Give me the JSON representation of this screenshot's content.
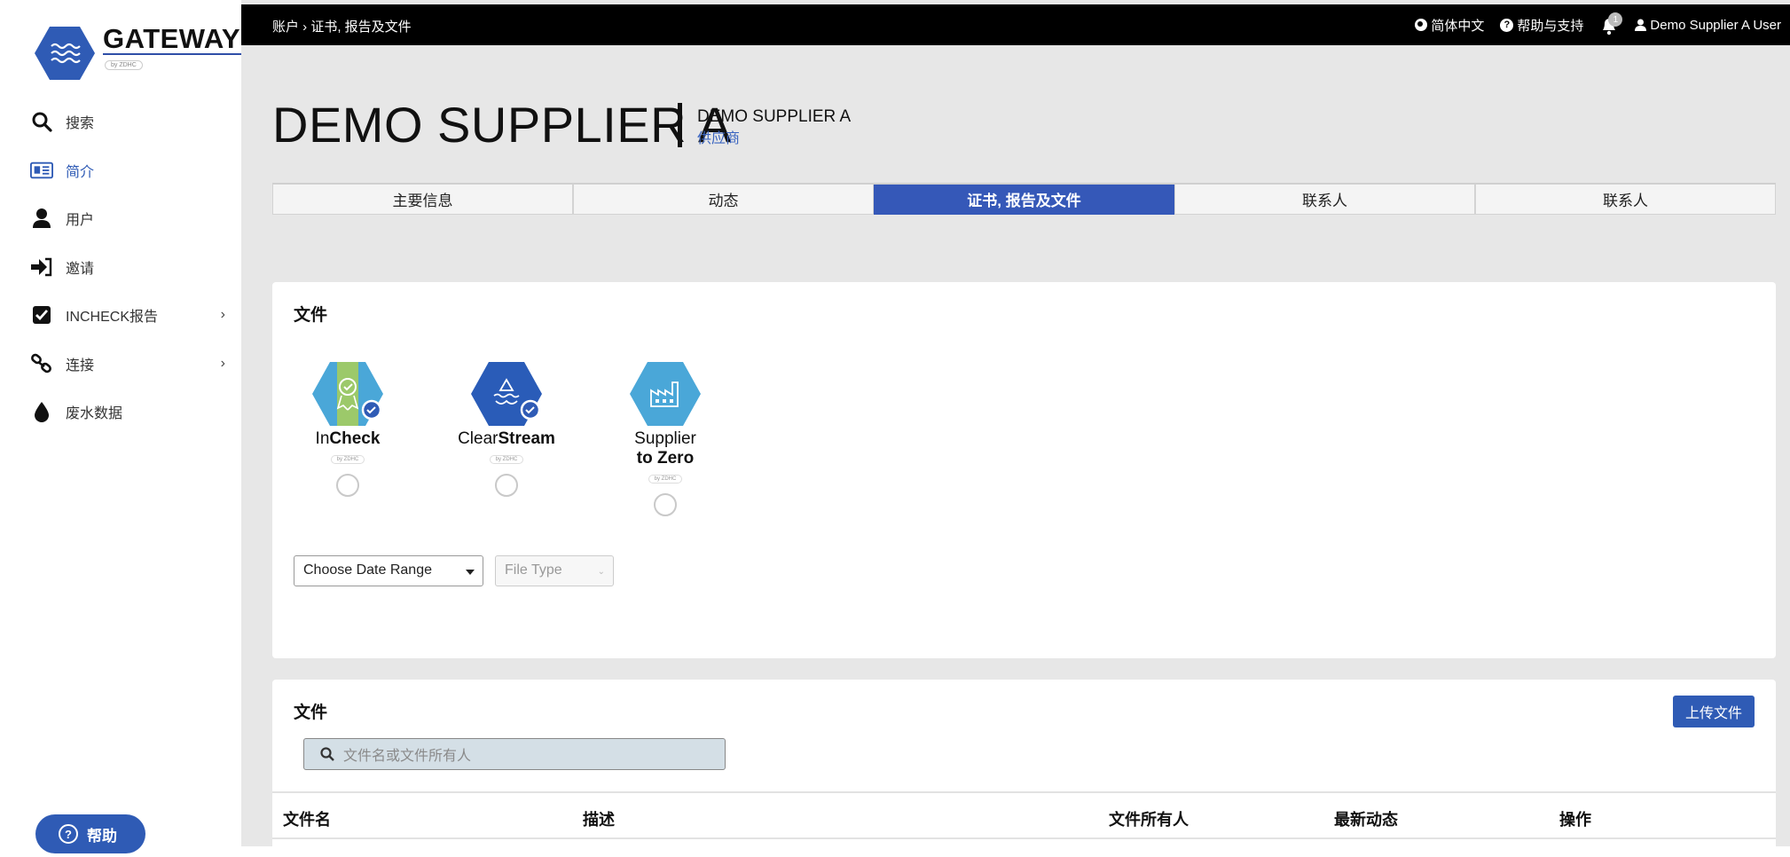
{
  "brand": {
    "name": "GATEWAY",
    "byline": "by ZDHC"
  },
  "sidebar": {
    "items": [
      {
        "label": "搜索",
        "icon": "search-icon",
        "active": false,
        "has_submenu": false
      },
      {
        "label": "简介",
        "icon": "profile-card-icon",
        "active": true,
        "has_submenu": false
      },
      {
        "label": "用户",
        "icon": "user-icon",
        "active": false,
        "has_submenu": false
      },
      {
        "label": "邀请",
        "icon": "invite-icon",
        "active": false,
        "has_submenu": false
      },
      {
        "label": "INCHECK报告",
        "icon": "checkbox-icon",
        "active": false,
        "has_submenu": true
      },
      {
        "label": "连接",
        "icon": "link-icon",
        "active": false,
        "has_submenu": true
      },
      {
        "label": "废水数据",
        "icon": "water-drop-icon",
        "active": false,
        "has_submenu": false
      }
    ],
    "help_label": "帮助"
  },
  "topbar": {
    "breadcrumb": "账户 › 证书, 报告及文件",
    "language": "简体中文",
    "help": "帮助与支持",
    "notification_count": "1",
    "user": "Demo Supplier A User"
  },
  "header": {
    "title": "DEMO SUPPLIER A",
    "subtitle": "DEMO SUPPLIER A",
    "role": "供应商"
  },
  "tabs": [
    {
      "label": "主要信息",
      "active": false
    },
    {
      "label": "动态",
      "active": false
    },
    {
      "label": "证书, 报告及文件",
      "active": true
    },
    {
      "label": "联系人",
      "active": false
    },
    {
      "label": "联系人",
      "active": false
    }
  ],
  "documents_card": {
    "title": "文件",
    "programs": [
      {
        "name_light": "In",
        "name_bold": "Check",
        "byline": "by ZDHC",
        "selected": false,
        "color": "#4aa7d8"
      },
      {
        "name_light": "Clear",
        "name_bold": "Stream",
        "byline": "by ZDHC",
        "selected": false,
        "color": "#2a5cb8"
      },
      {
        "name_light": "Supplier",
        "name_bold": "to Zero",
        "byline": "by ZDHC",
        "selected": false,
        "color": "#4aa7d8"
      }
    ],
    "date_range": {
      "value": "Choose Date Range"
    },
    "file_type": {
      "placeholder": "File Type"
    }
  },
  "files_card": {
    "title": "文件",
    "upload_label": "上传文件",
    "search_placeholder": "文件名或文件所有人",
    "columns": [
      "文件名",
      "描述",
      "文件所有人",
      "最新动态",
      "操作"
    ]
  },
  "colors": {
    "accent": "#3558b8",
    "topbar": "#000000",
    "content_bg": "#e7e7e7"
  }
}
